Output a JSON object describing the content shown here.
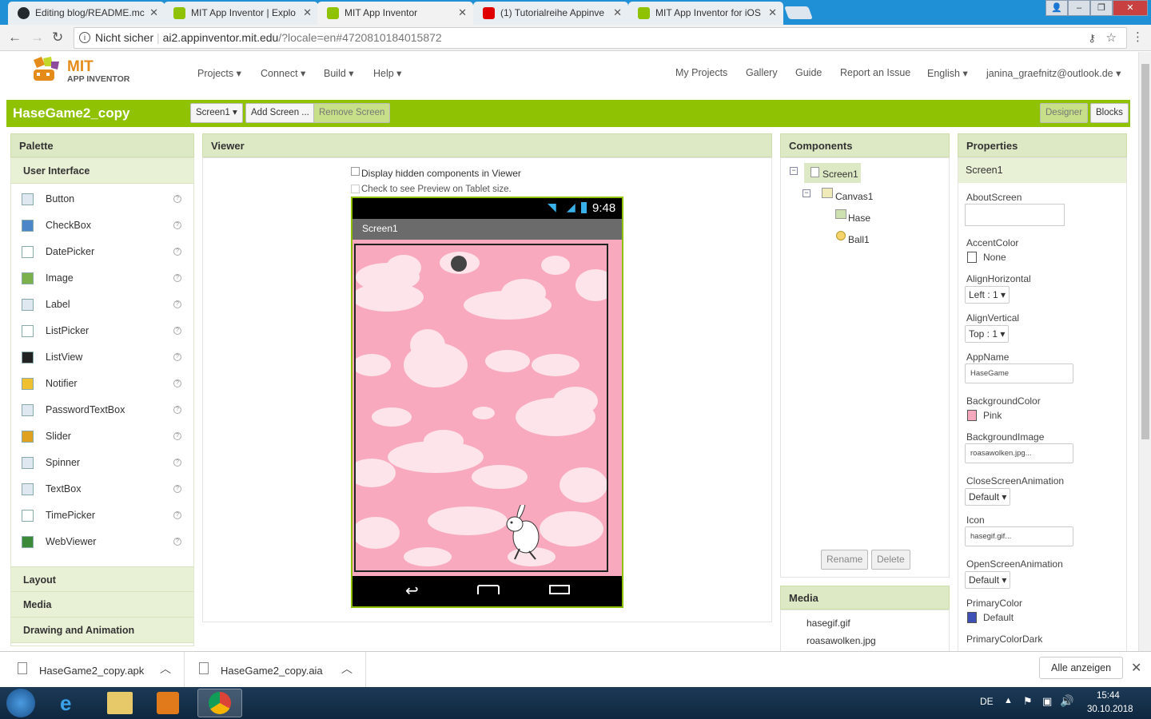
{
  "browser": {
    "tabs": [
      {
        "label": "Editing blog/README.mc",
        "favicon": "github-icon",
        "color": "#24292e"
      },
      {
        "label": "MIT App Inventor | Explo",
        "favicon": "appinventor-icon",
        "color": "#8fc202"
      },
      {
        "label": "MIT App Inventor",
        "favicon": "appinventor-icon",
        "color": "#8fc202"
      },
      {
        "label": "(1) Tutorialreihe Appinve",
        "favicon": "youtube-icon",
        "color": "#e00000"
      },
      {
        "label": "MIT App Inventor for iOS",
        "favicon": "appinventor-icon",
        "color": "#8fc202"
      }
    ],
    "security_label": "Nicht sicher",
    "url_host": "ai2.appinventor.mit.edu",
    "url_rest": "/?locale=en#4720810184015872"
  },
  "app_header": {
    "logo_title": "MIT",
    "logo_subtitle": "APP INVENTOR",
    "menus": [
      "Projects ▾",
      "Connect ▾",
      "Build ▾",
      "Help ▾"
    ],
    "right_links": [
      "My Projects",
      "Gallery",
      "Guide",
      "Report an Issue",
      "English ▾",
      "janina_graefnitz@outlook.de ▾"
    ]
  },
  "project_bar": {
    "project_name": "HaseGame2_copy",
    "screen_select": "Screen1 ▾",
    "add_screen": "Add Screen ...",
    "remove_screen": "Remove Screen",
    "designer": "Designer",
    "blocks": "Blocks"
  },
  "palette": {
    "title": "Palette",
    "section": "User Interface",
    "items": [
      "Button",
      "CheckBox",
      "DatePicker",
      "Image",
      "Label",
      "ListPicker",
      "ListView",
      "Notifier",
      "PasswordTextBox",
      "Slider",
      "Spinner",
      "TextBox",
      "TimePicker",
      "WebViewer"
    ],
    "collapsed_sections": [
      "Layout",
      "Media",
      "Drawing and Animation"
    ]
  },
  "viewer": {
    "title": "Viewer",
    "display_hidden": "Display hidden components in Viewer",
    "tablet_preview": "Check to see Preview on Tablet size.",
    "phone_time": "9:48",
    "screen_title": "Screen1",
    "canvas_color": "#f8a9be"
  },
  "components": {
    "title": "Components",
    "tree": [
      "Screen1",
      "Canvas1",
      "Hase",
      "Ball1"
    ],
    "rename": "Rename",
    "delete": "Delete"
  },
  "media": {
    "title": "Media",
    "files": [
      "hasegif.gif",
      "roasawolken.jpg"
    ]
  },
  "properties": {
    "title": "Properties",
    "component": "Screen1",
    "about_screen_label": "AboutScreen",
    "accent_color_label": "AccentColor",
    "accent_color_value": "None",
    "align_h_label": "AlignHorizontal",
    "align_h_value": "Left : 1 ▾",
    "align_v_label": "AlignVertical",
    "align_v_value": "Top : 1 ▾",
    "app_name_label": "AppName",
    "app_name_value": "HaseGame",
    "bg_color_label": "BackgroundColor",
    "bg_color_value": "Pink",
    "bg_image_label": "BackgroundImage",
    "bg_image_value": "roasawolken.jpg...",
    "close_anim_label": "CloseScreenAnimation",
    "close_anim_value": "Default ▾",
    "icon_label": "Icon",
    "icon_value": "hasegif.gif...",
    "open_anim_label": "OpenScreenAnimation",
    "open_anim_value": "Default ▾",
    "primary_color_label": "PrimaryColor",
    "primary_color_value": "Default",
    "primary_dark_label": "PrimaryColorDark"
  },
  "downloads": {
    "files": [
      "HaseGame2_copy.apk",
      "HaseGame2_copy.aia"
    ],
    "show_all": "Alle anzeigen"
  },
  "taskbar": {
    "lang": "DE",
    "time": "15:44",
    "date": "30.10.2018"
  }
}
